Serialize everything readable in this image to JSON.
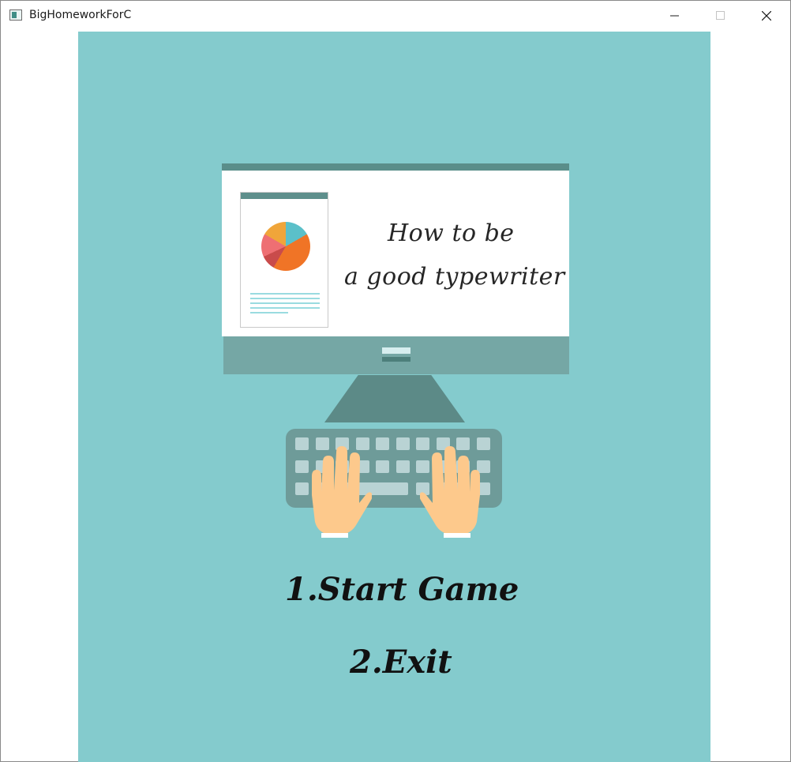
{
  "window": {
    "title": "BigHomeworkForC",
    "controls": [
      "minimize-icon",
      "maximize-icon",
      "close-icon"
    ]
  },
  "splash": {
    "screen_text_line1": "How to be",
    "screen_text_line2": "a good typewriter",
    "colors": {
      "background": "#84cbcd",
      "monitor_frame": "#5a8e8a",
      "monitor_chin": "#75a7a5",
      "keyboard": "#6e9b99",
      "skin": "#fdc98c"
    }
  },
  "menu": {
    "items": [
      {
        "label": "1.Start Game"
      },
      {
        "label": "2.Exit"
      }
    ]
  }
}
